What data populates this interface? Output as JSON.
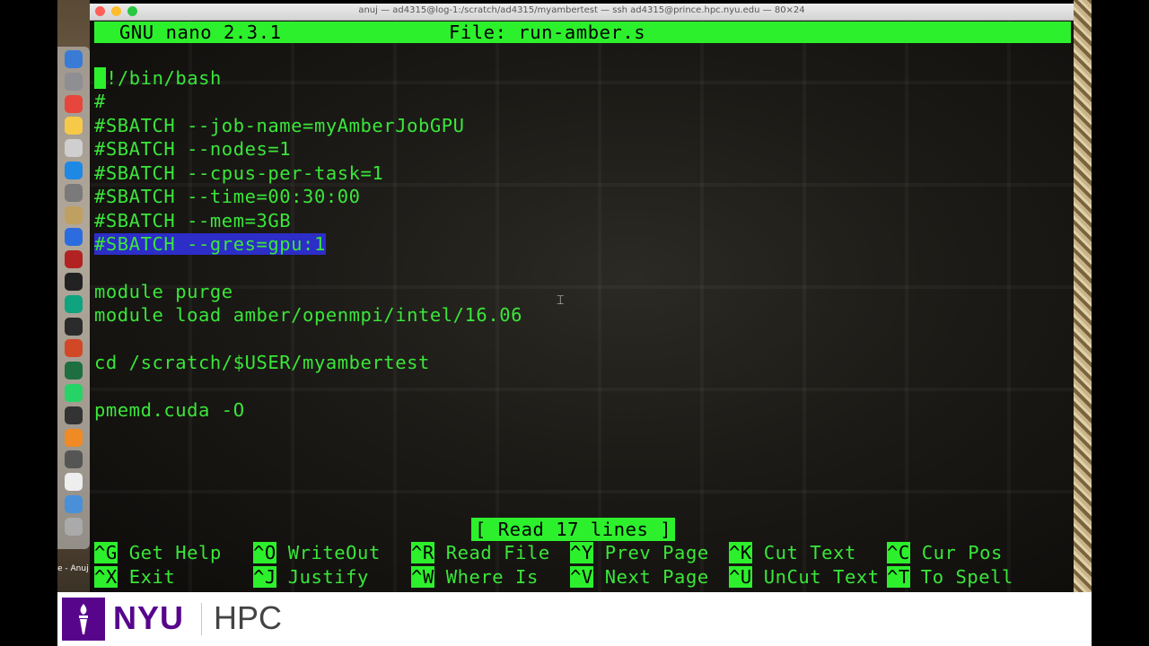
{
  "window": {
    "title": "anuj — ad4315@log-1:/scratch/ad4315/myambertest — ssh ad4315@prince.hpc.nyu.edu — 80×24"
  },
  "nano": {
    "version": "GNU nano 2.3.1",
    "file": "File: run-amber.s",
    "status": "[ Read 17 lines ]"
  },
  "code_lines": [
    "!/bin/bash",
    "#",
    "#SBATCH --job-name=myAmberJobGPU",
    "#SBATCH --nodes=1",
    "#SBATCH --cpus-per-task=1",
    "#SBATCH --time=00:30:00",
    "#SBATCH --mem=3GB",
    "#SBATCH --gres=gpu:1",
    "",
    "module purge",
    "module load amber/openmpi/intel/16.06",
    "",
    "cd /scratch/$USER/myambertest",
    "",
    "pmemd.cuda -O"
  ],
  "shortcuts": [
    {
      "key": "^G",
      "label": "Get Help"
    },
    {
      "key": "^O",
      "label": "WriteOut"
    },
    {
      "key": "^R",
      "label": "Read File"
    },
    {
      "key": "^Y",
      "label": "Prev Page"
    },
    {
      "key": "^K",
      "label": "Cut Text"
    },
    {
      "key": "^C",
      "label": "Cur Pos"
    },
    {
      "key": "^X",
      "label": "Exit"
    },
    {
      "key": "^J",
      "label": "Justify"
    },
    {
      "key": "^W",
      "label": "Where Is"
    },
    {
      "key": "^V",
      "label": "Next Page"
    },
    {
      "key": "^U",
      "label": "UnCut Text"
    },
    {
      "key": "^T",
      "label": "To Spell"
    }
  ],
  "desktop": {
    "file_label": "e - Anuj\nun.pdf"
  },
  "dock_icons": [
    "finder-icon",
    "launchpad-icon",
    "chrome-icon",
    "notes-icon",
    "textedit-icon",
    "safari-icon",
    "system-preferences-icon",
    "preview-icon",
    "xcode-icon",
    "photo-booth-icon",
    "terminal-icon",
    "chatgpt-icon",
    "activity-monitor-icon",
    "powerpoint-icon",
    "excel-icon",
    "whatsapp-icon",
    "obs-icon",
    "vlc-icon",
    "x11-icon",
    "document-icon",
    "folder-icon",
    "trash-icon"
  ],
  "colors": {
    "nano_green": "#2df02d",
    "text_green": "#3ae63a",
    "selection_blue": "#2d2dc8",
    "nyu_purple": "#57068c"
  },
  "branding": {
    "org": "NYU",
    "product": "HPC"
  }
}
